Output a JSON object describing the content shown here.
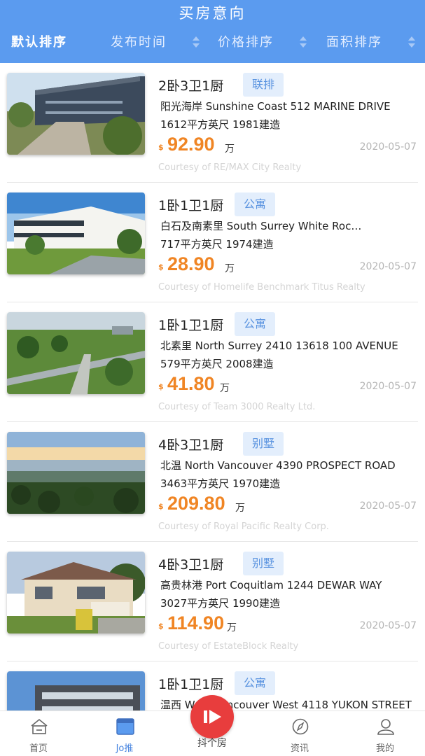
{
  "header": {
    "title": "买房意向"
  },
  "sort_bar": {
    "items": [
      {
        "label": "默认排序"
      },
      {
        "label": "发布时间"
      },
      {
        "label": "价格排序"
      },
      {
        "label": "面积排序"
      }
    ]
  },
  "listings": [
    {
      "layout": "2卧3卫1厨",
      "tag": "联排",
      "address": "阳光海岸 Sunshine Coast 512 MARINE DRIVE",
      "meta": "1612平方英尺 1981建造",
      "currency": "$",
      "price": "92.90",
      "unit": "万",
      "date": "2020-05-07",
      "courtesy": "Courtesy of RE/MAX City Realty"
    },
    {
      "layout": "1卧1卫1厨",
      "tag": "公寓",
      "address": "白石及南素里 South Surrey White Roc…",
      "meta": "717平方英尺 1974建造",
      "currency": "$",
      "price": "28.90",
      "unit": "万",
      "date": "2020-05-07",
      "courtesy": "Courtesy of Homelife Benchmark Titus Realty"
    },
    {
      "layout": "1卧1卫1厨",
      "tag": "公寓",
      "address": "北素里 North Surrey 2410 13618 100 AVENUE",
      "meta": "579平方英尺 2008建造",
      "currency": "$",
      "price": "41.80",
      "unit": "万",
      "date": "2020-05-07",
      "courtesy": "Courtesy of Team 3000 Realty Ltd."
    },
    {
      "layout": "4卧3卫1厨",
      "tag": "别墅",
      "address": "北温 North Vancouver 4390 PROSPECT ROAD",
      "meta": "3463平方英尺 1970建造",
      "currency": "$",
      "price": "209.80",
      "unit": "万",
      "date": "2020-05-07",
      "courtesy": "Courtesy of Royal Pacific Realty Corp."
    },
    {
      "layout": "4卧3卫1厨",
      "tag": "别墅",
      "address": "高贵林港 Port Coquitlam 1244 DEWAR WAY",
      "meta": "3027平方英尺 1990建造",
      "currency": "$",
      "price": "114.90",
      "unit": "万",
      "date": "2020-05-07",
      "courtesy": "Courtesy of EstateBlock Realty"
    },
    {
      "layout": "1卧1卫1厨",
      "tag": "公寓",
      "address": "温西 West Vancouver West 4118 YUKON STREET",
      "meta": "",
      "currency": "",
      "price": "",
      "unit": "",
      "date": "",
      "courtesy": ""
    }
  ],
  "tabbar": {
    "tabs": [
      {
        "label": "首页",
        "icon": "home-icon"
      },
      {
        "label": "Jo推",
        "icon": "recommend-icon"
      },
      {
        "label": "抖个房",
        "icon": "play-icon"
      },
      {
        "label": "资讯",
        "icon": "compass-icon"
      },
      {
        "label": "我的",
        "icon": "user-icon"
      }
    ]
  },
  "colors": {
    "header": "#5b9bef",
    "price": "#f08524",
    "tag_bg": "#e3eefc",
    "tag_text": "#5b94e0",
    "center_button": "#e83d3d",
    "active_tab": "#4a86e0"
  }
}
